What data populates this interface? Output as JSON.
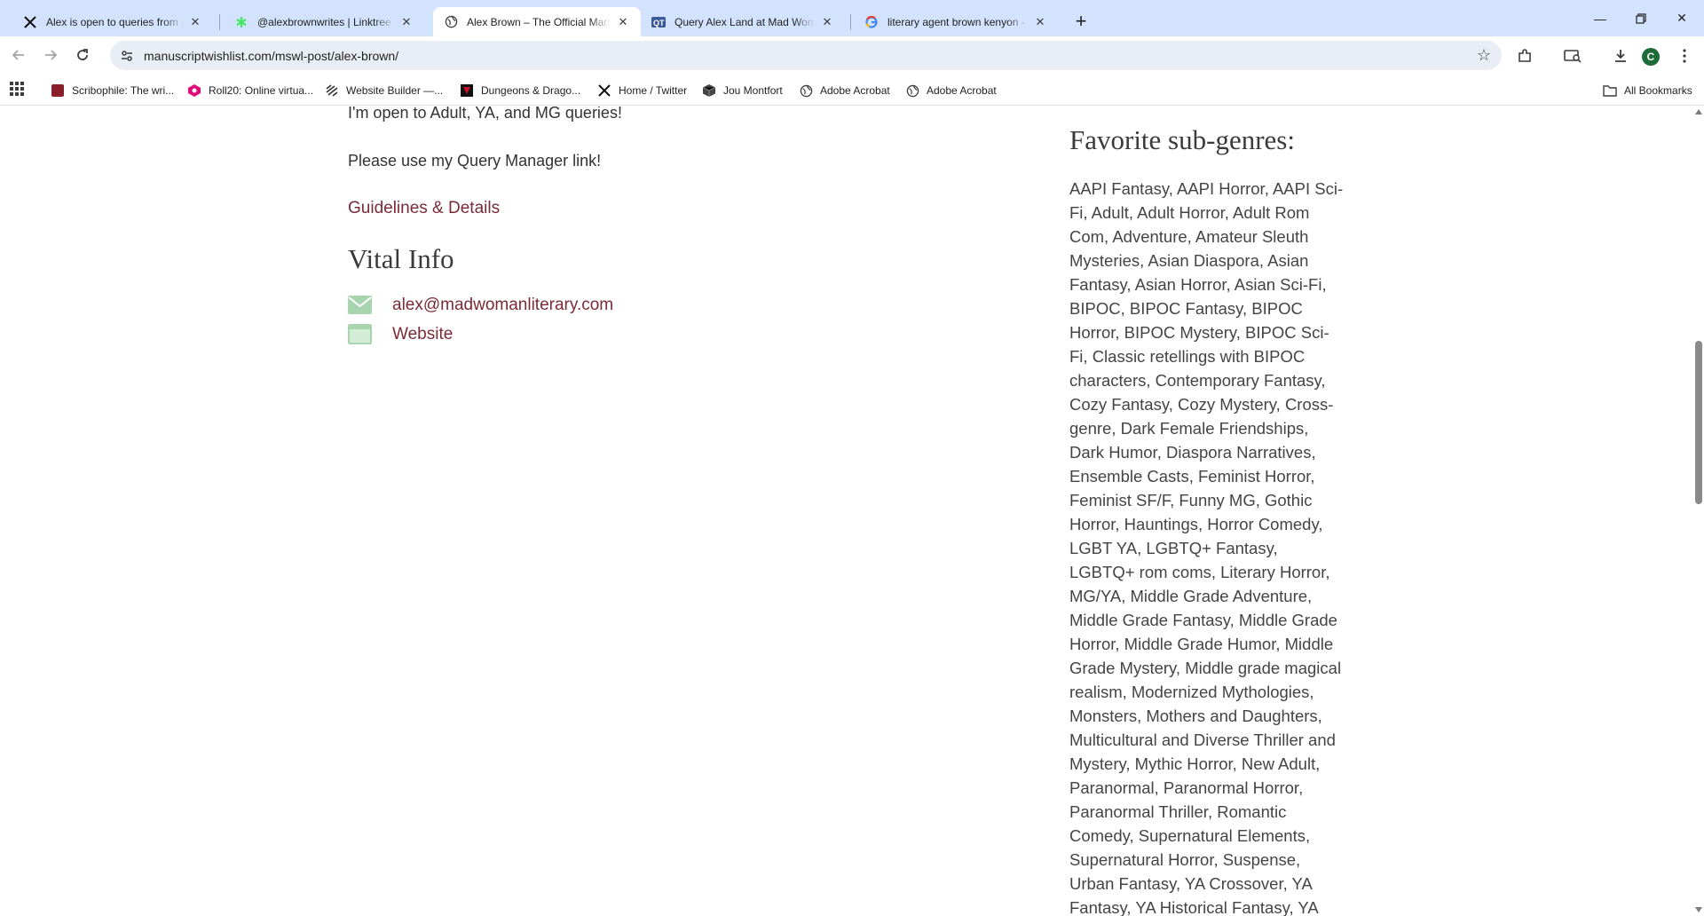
{
  "browser": {
    "tabs": [
      {
        "title": "Alex is open to queries from mad",
        "icon": "x-twitter-icon",
        "active": false
      },
      {
        "title": "@alexbrownwrites | Linktree",
        "icon": "linktree-icon",
        "active": false
      },
      {
        "title": "Alex Brown – The Official Manuscript",
        "icon": "globe-icon",
        "active": true
      },
      {
        "title": "Query Alex Land at Mad Woman",
        "icon": "querymanager-icon",
        "active": false
      },
      {
        "title": "literary agent brown kenyon - Google",
        "icon": "google-icon",
        "active": false
      }
    ],
    "url": "manuscriptwishlist.com/mswl-post/alex-brown/",
    "profile_initial": "C",
    "bookmarks": [
      {
        "label": "Scribophile: The wri...",
        "icon": "scribophile-icon"
      },
      {
        "label": "Roll20: Online virtua...",
        "icon": "roll20-icon"
      },
      {
        "label": "Website Builder —...",
        "icon": "website-builder-icon"
      },
      {
        "label": "Dungeons & Drago...",
        "icon": "dnd-icon"
      },
      {
        "label": "Home / Twitter",
        "icon": "x-twitter-icon"
      },
      {
        "label": "Jou Montfort",
        "icon": "cube-icon"
      },
      {
        "label": "Adobe Acrobat",
        "icon": "globe-icon"
      },
      {
        "label": "Adobe Acrobat",
        "icon": "globe-icon"
      }
    ],
    "all_bookmarks_label": "All Bookmarks"
  },
  "page": {
    "queries_line": "I'm open to Adult, YA, and MG queries!",
    "query_manager_line": "Please use my Query Manager link!",
    "guidelines_link": "Guidelines & Details",
    "vital_info": {
      "heading": "Vital Info",
      "email": "alex@madwomanliterary.com",
      "website": "Website"
    },
    "subgenres": {
      "heading": "Favorite sub-genres:",
      "text": "AAPI Fantasy, AAPI Horror, AAPI Sci-Fi, Adult, Adult Horror, Adult Rom Com, Adventure, Amateur Sleuth Mysteries, Asian Diaspora, Asian Fantasy, Asian Horror, Asian Sci-Fi, BIPOC, BIPOC Fantasy, BIPOC Horror, BIPOC Mystery, BIPOC Sci-Fi, Classic retellings with BIPOC characters, Contemporary Fantasy, Cozy Fantasy, Cozy Mystery, Cross-genre, Dark Female Friendships, Dark Humor, Diaspora Narratives, Ensemble Casts, Feminist Horror, Feminist SF/F, Funny MG, Gothic Horror, Hauntings, Horror Comedy, LGBT YA, LGBTQ+ Fantasy, LGBTQ+ rom coms, Literary Horror, MG/YA, Middle Grade Adventure, Middle Grade Fantasy, Middle Grade Horror, Middle Grade Humor, Middle Grade Mystery, Middle grade magical realism, Modernized Mythologies, Monsters, Mothers and Daughters, Multicultural and Diverse Thriller and Mystery, Mythic Horror, New Adult, Paranormal, Paranormal Horror, Paranormal Thriller, Romantic Comedy, Supernatural Elements, Supernatural Horror, Suspense, Urban Fantasy, YA Crossover, YA Fantasy, YA Historical Fantasy, YA"
    }
  },
  "colors": {
    "tab_strip": "#d3e3fd",
    "omnibox": "#e9eef6",
    "link": "#7a2a38",
    "icon_green": "#a8d5b0"
  }
}
